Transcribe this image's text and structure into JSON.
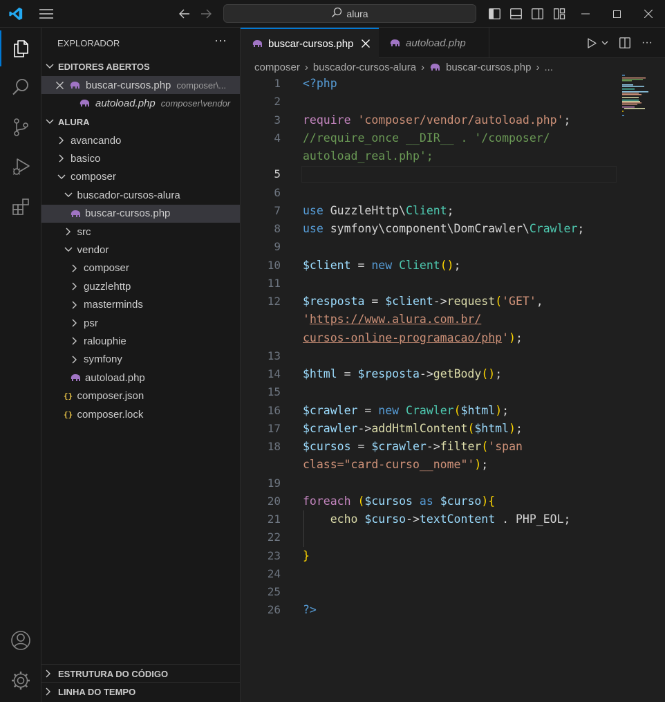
{
  "titlebar": {
    "search_text": "alura"
  },
  "sidebar": {
    "title": "EXPLORADOR",
    "open_editors_header": "EDITORES ABERTOS",
    "open_editors": [
      {
        "name": "buscar-cursos.php",
        "desc": "composer\\...",
        "active": true
      },
      {
        "name": "autoload.php",
        "desc": "composer\\vendor",
        "active": false
      }
    ],
    "folder_header": "ALURA",
    "tree": [
      {
        "label": "avancando",
        "type": "folder",
        "expanded": false,
        "depth": 0
      },
      {
        "label": "basico",
        "type": "folder",
        "expanded": false,
        "depth": 0
      },
      {
        "label": "composer",
        "type": "folder",
        "expanded": true,
        "depth": 0
      },
      {
        "label": "buscador-cursos-alura",
        "type": "folder",
        "expanded": true,
        "depth": 1
      },
      {
        "label": "buscar-cursos.php",
        "type": "php",
        "depth": 2,
        "selected": true
      },
      {
        "label": "src",
        "type": "folder",
        "expanded": false,
        "depth": 1
      },
      {
        "label": "vendor",
        "type": "folder",
        "expanded": true,
        "depth": 1
      },
      {
        "label": "composer",
        "type": "folder",
        "expanded": false,
        "depth": 2
      },
      {
        "label": "guzzlehttp",
        "type": "folder",
        "expanded": false,
        "depth": 2
      },
      {
        "label": "masterminds",
        "type": "folder",
        "expanded": false,
        "depth": 2
      },
      {
        "label": "psr",
        "type": "folder",
        "expanded": false,
        "depth": 2
      },
      {
        "label": "ralouphie",
        "type": "folder",
        "expanded": false,
        "depth": 2
      },
      {
        "label": "symfony",
        "type": "folder",
        "expanded": false,
        "depth": 2
      },
      {
        "label": "autoload.php",
        "type": "php",
        "depth": 2
      },
      {
        "label": "composer.json",
        "type": "json",
        "depth": 1
      },
      {
        "label": "composer.lock",
        "type": "json",
        "depth": 1
      }
    ],
    "outline_header": "ESTRUTURA DO CÓDIGO",
    "timeline_header": "LINHA DO TEMPO"
  },
  "tabs": [
    {
      "label": "buscar-cursos.php",
      "active": true
    },
    {
      "label": "autoload.php",
      "active": false
    }
  ],
  "breadcrumb": [
    "composer",
    "buscador-cursos-alura",
    "buscar-cursos.php",
    "..."
  ],
  "editor": {
    "current_line": 5,
    "lines": [
      {
        "n": "1",
        "t": [
          [
            "<?php",
            "kw"
          ]
        ]
      },
      {
        "n": "2",
        "t": []
      },
      {
        "n": "3",
        "t": [
          [
            "require ",
            "ctl"
          ],
          [
            "'composer/vendor/autoload.php'",
            "str"
          ],
          [
            ";",
            "pn"
          ]
        ]
      },
      {
        "n": "4",
        "t": [
          [
            "//require_once __DIR__ . '/composer/",
            "cm"
          ]
        ]
      },
      {
        "n": "",
        "t": [
          [
            "autoload_real.php';",
            "cm"
          ]
        ]
      },
      {
        "n": "5",
        "t": []
      },
      {
        "n": "6",
        "t": []
      },
      {
        "n": "7",
        "t": [
          [
            "use ",
            "kw"
          ],
          [
            "GuzzleHttp",
            "pn"
          ],
          [
            "\\",
            "pn"
          ],
          [
            "Client",
            "cls"
          ],
          [
            ";",
            "pn"
          ]
        ]
      },
      {
        "n": "8",
        "t": [
          [
            "use ",
            "kw"
          ],
          [
            "symfony\\component\\DomCrawler",
            "pn"
          ],
          [
            "\\",
            "pn"
          ],
          [
            "Crawler",
            "cls"
          ],
          [
            ";",
            "pn"
          ]
        ]
      },
      {
        "n": "9",
        "t": []
      },
      {
        "n": "10",
        "t": [
          [
            "$client",
            "var"
          ],
          [
            " = ",
            "pn"
          ],
          [
            "new ",
            "kw"
          ],
          [
            "Client",
            "cls"
          ],
          [
            "()",
            "br"
          ],
          [
            ";",
            "pn"
          ]
        ]
      },
      {
        "n": "11",
        "t": []
      },
      {
        "n": "12",
        "t": [
          [
            "$resposta",
            "var"
          ],
          [
            " = ",
            "pn"
          ],
          [
            "$client",
            "var"
          ],
          [
            "->",
            "pn"
          ],
          [
            "request",
            "fn"
          ],
          [
            "(",
            "br"
          ],
          [
            "'GET'",
            "str"
          ],
          [
            ",",
            "pn"
          ]
        ]
      },
      {
        "n": "",
        "t": [
          [
            "'",
            "str"
          ],
          [
            "https://www.alura.com.br/",
            "link"
          ]
        ]
      },
      {
        "n": "",
        "t": [
          [
            "cursos-online-programacao/php",
            "link"
          ],
          [
            "'",
            "str"
          ],
          [
            ")",
            "br"
          ],
          [
            ";",
            "pn"
          ]
        ]
      },
      {
        "n": "13",
        "t": []
      },
      {
        "n": "14",
        "t": [
          [
            "$html",
            "var"
          ],
          [
            " = ",
            "pn"
          ],
          [
            "$resposta",
            "var"
          ],
          [
            "->",
            "pn"
          ],
          [
            "getBody",
            "fn"
          ],
          [
            "()",
            "br"
          ],
          [
            ";",
            "pn"
          ]
        ]
      },
      {
        "n": "15",
        "t": []
      },
      {
        "n": "16",
        "t": [
          [
            "$crawler",
            "var"
          ],
          [
            " = ",
            "pn"
          ],
          [
            "new ",
            "kw"
          ],
          [
            "Crawler",
            "cls"
          ],
          [
            "(",
            "br"
          ],
          [
            "$html",
            "var"
          ],
          [
            ")",
            "br"
          ],
          [
            ";",
            "pn"
          ]
        ]
      },
      {
        "n": "17",
        "t": [
          [
            "$crawler",
            "var"
          ],
          [
            "->",
            "pn"
          ],
          [
            "addHtmlContent",
            "fn"
          ],
          [
            "(",
            "br"
          ],
          [
            "$html",
            "var"
          ],
          [
            ")",
            "br"
          ],
          [
            ";",
            "pn"
          ]
        ]
      },
      {
        "n": "18",
        "t": [
          [
            "$cursos",
            "var"
          ],
          [
            " = ",
            "pn"
          ],
          [
            "$crawler",
            "var"
          ],
          [
            "->",
            "pn"
          ],
          [
            "filter",
            "fn"
          ],
          [
            "(",
            "br"
          ],
          [
            "'span",
            "str"
          ]
        ]
      },
      {
        "n": "",
        "t": [
          [
            "class=\"card-curso__nome\"'",
            "str"
          ],
          [
            ")",
            "br"
          ],
          [
            ";",
            "pn"
          ]
        ]
      },
      {
        "n": "19",
        "t": []
      },
      {
        "n": "20",
        "t": [
          [
            "foreach ",
            "ctl"
          ],
          [
            "(",
            "br"
          ],
          [
            "$cursos",
            "var"
          ],
          [
            " as ",
            "kw"
          ],
          [
            "$curso",
            "var"
          ],
          [
            ")",
            "br"
          ],
          [
            "{",
            "br"
          ]
        ]
      },
      {
        "n": "21",
        "t": [
          [
            "    echo ",
            "fn"
          ],
          [
            "$curso",
            "var"
          ],
          [
            "->",
            "pn"
          ],
          [
            "textContent",
            "var"
          ],
          [
            " . PHP_EOL;",
            "pn"
          ]
        ]
      },
      {
        "n": "22",
        "t": []
      },
      {
        "n": "23",
        "t": [
          [
            "}",
            "br"
          ]
        ]
      },
      {
        "n": "24",
        "t": []
      },
      {
        "n": "25",
        "t": []
      },
      {
        "n": "26",
        "t": [
          [
            "?>",
            "kw"
          ]
        ]
      }
    ]
  }
}
